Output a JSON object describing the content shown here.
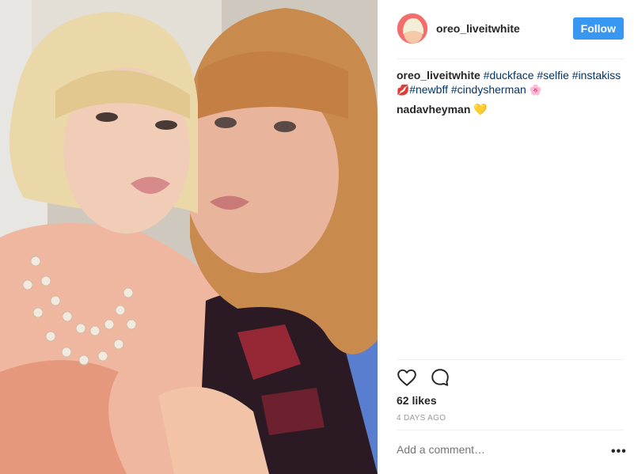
{
  "post": {
    "username": "oreo_liveitwhite",
    "follow_label": "Follow",
    "caption": {
      "username": "oreo_liveitwhite",
      "tags": [
        "#duckface",
        "#selfie",
        "#instakiss",
        "#newbff",
        "#cindysherman"
      ],
      "kiss_emoji": "💋",
      "flower_emoji": "🌸"
    },
    "comment": {
      "username": "nadavheyman",
      "emoji": "💛"
    },
    "likes": "62 likes",
    "time_ago": "4 DAYS AGO",
    "comment_placeholder": "Add a comment…",
    "more_label": "•••"
  },
  "colors": {
    "follow_button": "#3897f0",
    "hashtag": "#003569",
    "muted": "#999999",
    "text": "#262626"
  },
  "icons": {
    "like": "heart-icon",
    "comment": "comment-bubble-icon",
    "more": "more-options-icon"
  }
}
